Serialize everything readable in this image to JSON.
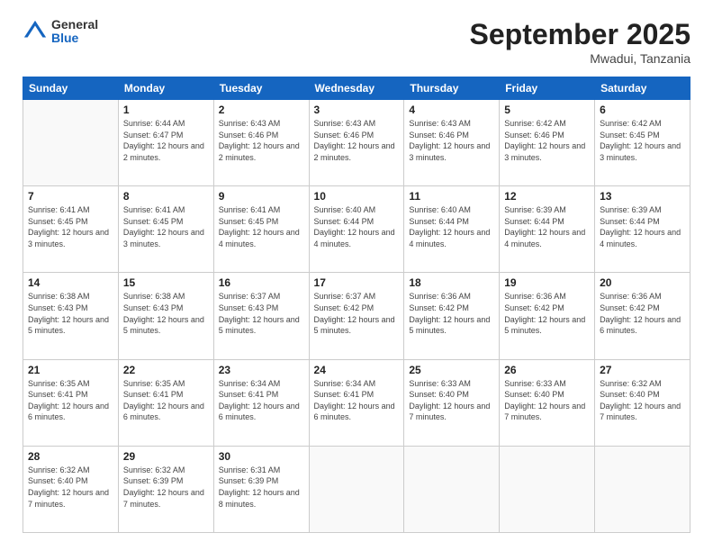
{
  "logo": {
    "general": "General",
    "blue": "Blue"
  },
  "title": "September 2025",
  "location": "Mwadui, Tanzania",
  "days_of_week": [
    "Sunday",
    "Monday",
    "Tuesday",
    "Wednesday",
    "Thursday",
    "Friday",
    "Saturday"
  ],
  "weeks": [
    [
      {
        "day": "",
        "sunrise": "",
        "sunset": "",
        "daylight": ""
      },
      {
        "day": "1",
        "sunrise": "Sunrise: 6:44 AM",
        "sunset": "Sunset: 6:47 PM",
        "daylight": "Daylight: 12 hours and 2 minutes."
      },
      {
        "day": "2",
        "sunrise": "Sunrise: 6:43 AM",
        "sunset": "Sunset: 6:46 PM",
        "daylight": "Daylight: 12 hours and 2 minutes."
      },
      {
        "day": "3",
        "sunrise": "Sunrise: 6:43 AM",
        "sunset": "Sunset: 6:46 PM",
        "daylight": "Daylight: 12 hours and 2 minutes."
      },
      {
        "day": "4",
        "sunrise": "Sunrise: 6:43 AM",
        "sunset": "Sunset: 6:46 PM",
        "daylight": "Daylight: 12 hours and 3 minutes."
      },
      {
        "day": "5",
        "sunrise": "Sunrise: 6:42 AM",
        "sunset": "Sunset: 6:46 PM",
        "daylight": "Daylight: 12 hours and 3 minutes."
      },
      {
        "day": "6",
        "sunrise": "Sunrise: 6:42 AM",
        "sunset": "Sunset: 6:45 PM",
        "daylight": "Daylight: 12 hours and 3 minutes."
      }
    ],
    [
      {
        "day": "7",
        "sunrise": "Sunrise: 6:41 AM",
        "sunset": "Sunset: 6:45 PM",
        "daylight": "Daylight: 12 hours and 3 minutes."
      },
      {
        "day": "8",
        "sunrise": "Sunrise: 6:41 AM",
        "sunset": "Sunset: 6:45 PM",
        "daylight": "Daylight: 12 hours and 3 minutes."
      },
      {
        "day": "9",
        "sunrise": "Sunrise: 6:41 AM",
        "sunset": "Sunset: 6:45 PM",
        "daylight": "Daylight: 12 hours and 4 minutes."
      },
      {
        "day": "10",
        "sunrise": "Sunrise: 6:40 AM",
        "sunset": "Sunset: 6:44 PM",
        "daylight": "Daylight: 12 hours and 4 minutes."
      },
      {
        "day": "11",
        "sunrise": "Sunrise: 6:40 AM",
        "sunset": "Sunset: 6:44 PM",
        "daylight": "Daylight: 12 hours and 4 minutes."
      },
      {
        "day": "12",
        "sunrise": "Sunrise: 6:39 AM",
        "sunset": "Sunset: 6:44 PM",
        "daylight": "Daylight: 12 hours and 4 minutes."
      },
      {
        "day": "13",
        "sunrise": "Sunrise: 6:39 AM",
        "sunset": "Sunset: 6:44 PM",
        "daylight": "Daylight: 12 hours and 4 minutes."
      }
    ],
    [
      {
        "day": "14",
        "sunrise": "Sunrise: 6:38 AM",
        "sunset": "Sunset: 6:43 PM",
        "daylight": "Daylight: 12 hours and 5 minutes."
      },
      {
        "day": "15",
        "sunrise": "Sunrise: 6:38 AM",
        "sunset": "Sunset: 6:43 PM",
        "daylight": "Daylight: 12 hours and 5 minutes."
      },
      {
        "day": "16",
        "sunrise": "Sunrise: 6:37 AM",
        "sunset": "Sunset: 6:43 PM",
        "daylight": "Daylight: 12 hours and 5 minutes."
      },
      {
        "day": "17",
        "sunrise": "Sunrise: 6:37 AM",
        "sunset": "Sunset: 6:42 PM",
        "daylight": "Daylight: 12 hours and 5 minutes."
      },
      {
        "day": "18",
        "sunrise": "Sunrise: 6:36 AM",
        "sunset": "Sunset: 6:42 PM",
        "daylight": "Daylight: 12 hours and 5 minutes."
      },
      {
        "day": "19",
        "sunrise": "Sunrise: 6:36 AM",
        "sunset": "Sunset: 6:42 PM",
        "daylight": "Daylight: 12 hours and 5 minutes."
      },
      {
        "day": "20",
        "sunrise": "Sunrise: 6:36 AM",
        "sunset": "Sunset: 6:42 PM",
        "daylight": "Daylight: 12 hours and 6 minutes."
      }
    ],
    [
      {
        "day": "21",
        "sunrise": "Sunrise: 6:35 AM",
        "sunset": "Sunset: 6:41 PM",
        "daylight": "Daylight: 12 hours and 6 minutes."
      },
      {
        "day": "22",
        "sunrise": "Sunrise: 6:35 AM",
        "sunset": "Sunset: 6:41 PM",
        "daylight": "Daylight: 12 hours and 6 minutes."
      },
      {
        "day": "23",
        "sunrise": "Sunrise: 6:34 AM",
        "sunset": "Sunset: 6:41 PM",
        "daylight": "Daylight: 12 hours and 6 minutes."
      },
      {
        "day": "24",
        "sunrise": "Sunrise: 6:34 AM",
        "sunset": "Sunset: 6:41 PM",
        "daylight": "Daylight: 12 hours and 6 minutes."
      },
      {
        "day": "25",
        "sunrise": "Sunrise: 6:33 AM",
        "sunset": "Sunset: 6:40 PM",
        "daylight": "Daylight: 12 hours and 7 minutes."
      },
      {
        "day": "26",
        "sunrise": "Sunrise: 6:33 AM",
        "sunset": "Sunset: 6:40 PM",
        "daylight": "Daylight: 12 hours and 7 minutes."
      },
      {
        "day": "27",
        "sunrise": "Sunrise: 6:32 AM",
        "sunset": "Sunset: 6:40 PM",
        "daylight": "Daylight: 12 hours and 7 minutes."
      }
    ],
    [
      {
        "day": "28",
        "sunrise": "Sunrise: 6:32 AM",
        "sunset": "Sunset: 6:40 PM",
        "daylight": "Daylight: 12 hours and 7 minutes."
      },
      {
        "day": "29",
        "sunrise": "Sunrise: 6:32 AM",
        "sunset": "Sunset: 6:39 PM",
        "daylight": "Daylight: 12 hours and 7 minutes."
      },
      {
        "day": "30",
        "sunrise": "Sunrise: 6:31 AM",
        "sunset": "Sunset: 6:39 PM",
        "daylight": "Daylight: 12 hours and 8 minutes."
      },
      {
        "day": "",
        "sunrise": "",
        "sunset": "",
        "daylight": ""
      },
      {
        "day": "",
        "sunrise": "",
        "sunset": "",
        "daylight": ""
      },
      {
        "day": "",
        "sunrise": "",
        "sunset": "",
        "daylight": ""
      },
      {
        "day": "",
        "sunrise": "",
        "sunset": "",
        "daylight": ""
      }
    ]
  ]
}
